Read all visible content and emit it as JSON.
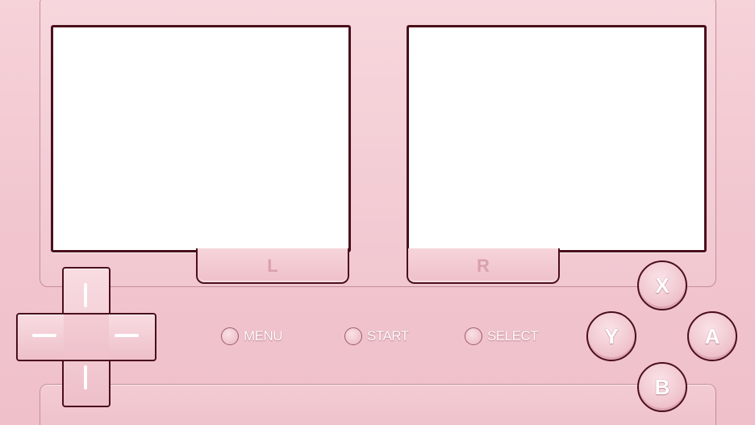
{
  "screens": {
    "left": "",
    "right": ""
  },
  "shoulders": {
    "left_label": "L",
    "right_label": "R"
  },
  "dpad": {
    "directions": [
      "up",
      "down",
      "left",
      "right"
    ]
  },
  "system_buttons": {
    "menu_label": "MENU",
    "start_label": "START",
    "select_label": "SELECT"
  },
  "face_buttons": {
    "x_label": "X",
    "y_label": "Y",
    "a_label": "A",
    "b_label": "B"
  },
  "colors": {
    "body": "#f2c8d0",
    "outline": "#4a0f1c",
    "screen": "#ffffff",
    "label_muted": "#d9a1ad"
  }
}
